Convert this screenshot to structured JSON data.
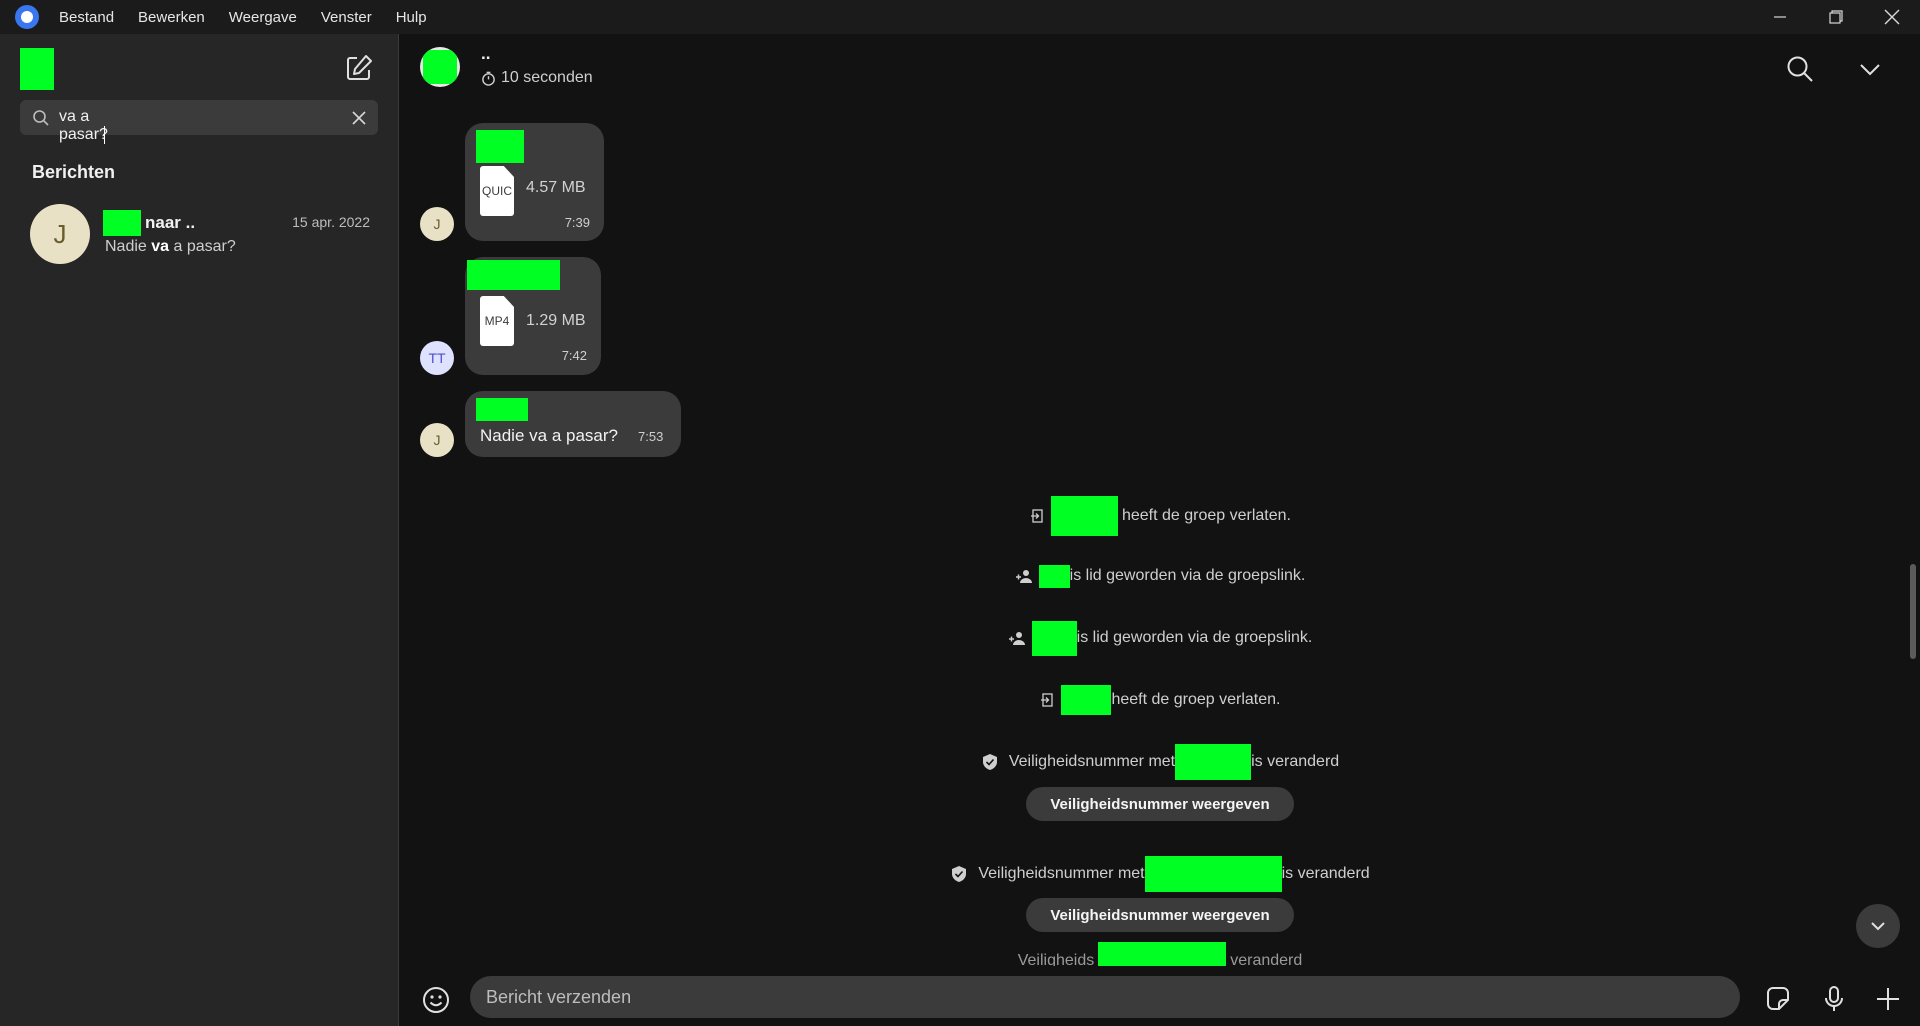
{
  "menu": {
    "items": [
      "Bestand",
      "Bewerken",
      "Weergave",
      "Venster",
      "Hulp"
    ]
  },
  "sidebar": {
    "search_value": "va a pasar?",
    "section_title": "Berichten",
    "result": {
      "avatar_initial": "J",
      "name_suffix": "naar ..",
      "date": "15 apr. 2022",
      "snippet_before": "Nadie ",
      "snippet_highlight": "va",
      "snippet_after": " a pasar?"
    }
  },
  "chat": {
    "title": "..",
    "disappearing_timer": "10 seconden",
    "messages": [
      {
        "avatar": "J",
        "file_ext": "QUIC",
        "size": "4.57 MB",
        "time": "7:39"
      },
      {
        "avatar": "TT",
        "file_ext": "MP4",
        "size": "1.29 MB",
        "time": "7:42"
      },
      {
        "avatar": "J",
        "text": "Nadie va a pasar?",
        "time": "7:53"
      }
    ],
    "system": {
      "left_group": "heeft de groep verlaten.",
      "joined": "is lid geworden via de groepslink.",
      "safety_prefix": "Veiligheidsnummer met",
      "safety_suffix": "is veranderd",
      "safety_button": "Veiligheidsnummer weergeven",
      "partial_prefix": "Veiligheids",
      "partial_suffix": "veranderd"
    },
    "composer_placeholder": "Bericht verzenden"
  }
}
